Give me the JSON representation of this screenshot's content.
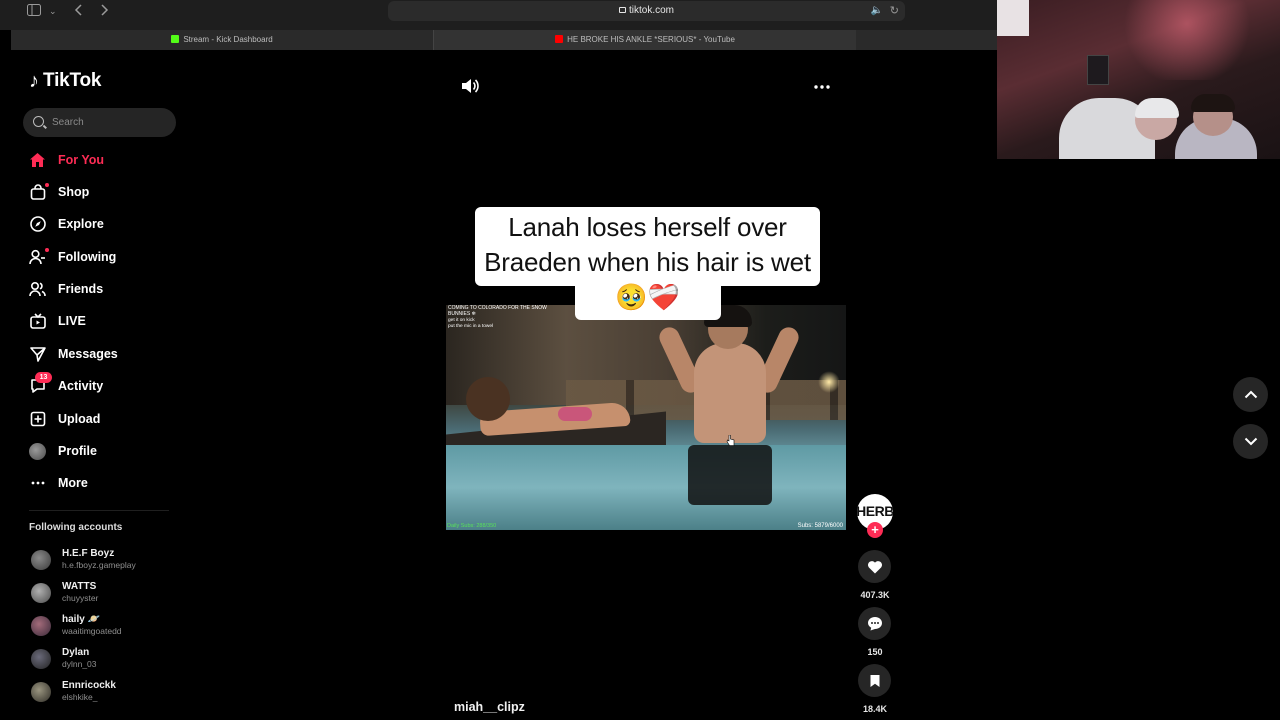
{
  "browser": {
    "url": "tiktok.com",
    "tabs": [
      {
        "title": "Stream - Kick Dashboard",
        "favicon_color": "#53fc18"
      },
      {
        "title": "HE BROKE HIS ANKLE *SERIOUS* - YouTube",
        "favicon_color": "#ff0000"
      }
    ]
  },
  "tiktok": {
    "logo_text": "TikTok",
    "search": {
      "placeholder": "Search"
    },
    "nav": [
      {
        "label": "For You",
        "icon": "home-icon",
        "active": true
      },
      {
        "label": "Shop",
        "icon": "shopping-bag-icon"
      },
      {
        "label": "Explore",
        "icon": "compass-icon"
      },
      {
        "label": "Following",
        "icon": "following-icon",
        "dot": true
      },
      {
        "label": "Friends",
        "icon": "friends-icon"
      },
      {
        "label": "LIVE",
        "icon": "live-icon"
      },
      {
        "label": "Messages",
        "icon": "messages-icon"
      },
      {
        "label": "Activity",
        "icon": "activity-icon",
        "badge": "13"
      },
      {
        "label": "Upload",
        "icon": "upload-icon"
      },
      {
        "label": "Profile",
        "icon": "profile-avatar"
      },
      {
        "label": "More",
        "icon": "more-icon"
      }
    ],
    "following_title": "Following accounts",
    "following_accounts": [
      {
        "name": "H.E.F Boyz",
        "handle": "h.e.fboyz.gameplay"
      },
      {
        "name": "WATTS",
        "handle": "chuyyster"
      },
      {
        "name": "haily 🪐",
        "handle": "waaitimgoatedd"
      },
      {
        "name": "Dylan",
        "handle": "dylnn_03"
      },
      {
        "name": "Ennricockk",
        "handle": "elshkike_"
      }
    ]
  },
  "video": {
    "caption": "Lanah loses herself over Braeden when his hair is wet 🥹❤️‍🩹",
    "overlay_title": "COMING TO COLORADO FOR THE SNOW BUNNIES ❄",
    "overlay_chat": [
      {
        "user": "",
        "text": "get it on kick"
      },
      {
        "user": "",
        "text": "put the mic in a towel"
      }
    ],
    "daily_subs": "Daily Subs: 288/350",
    "subs": "Subs: 5879/6000",
    "username": "miah__clipz",
    "creator_avatar_text": "HERB",
    "likes": "407.3K",
    "comments": "150",
    "saves": "18.4K"
  }
}
